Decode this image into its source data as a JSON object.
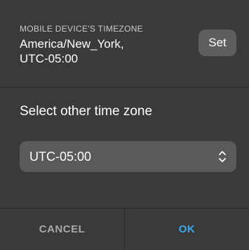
{
  "device_timezone": {
    "caption": "MOBILE DEVICE'S TIMEZONE",
    "line1": "America/New_York,",
    "line2": "UTC-05:00",
    "set_label": "Set"
  },
  "select": {
    "heading": "Select other time zone",
    "selected_value": "UTC-05:00",
    "icon": "chevron-up-down-icon"
  },
  "footer": {
    "cancel_label": "CANCEL",
    "ok_label": "OK"
  },
  "colors": {
    "background": "#3a3a3a",
    "accent": "#3fa8e6",
    "select_bg": "#5a5a5a",
    "button_bg": "#5e5e5e"
  }
}
